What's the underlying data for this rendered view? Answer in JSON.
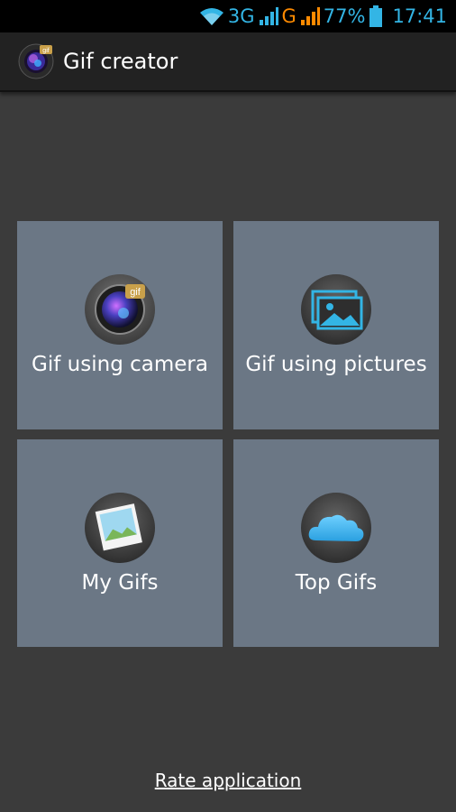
{
  "status": {
    "network_1": "3G",
    "network_2": "G",
    "battery": "77%",
    "time": "17:41"
  },
  "app": {
    "title": "Gif creator",
    "logo_badge": "gif"
  },
  "tiles": [
    {
      "label": "Gif using camera",
      "icon": "camera-gif-icon"
    },
    {
      "label": "Gif using pictures",
      "icon": "pictures-icon"
    },
    {
      "label": "My Gifs",
      "icon": "photo-icon"
    },
    {
      "label": "Top Gifs",
      "icon": "cloud-icon"
    }
  ],
  "footer": {
    "rate_label": "Rate application"
  },
  "colors": {
    "background": "#3b3b3b",
    "tile": "#6b7785",
    "accent_blue": "#33b5e5",
    "accent_orange": "#ff8a00"
  }
}
